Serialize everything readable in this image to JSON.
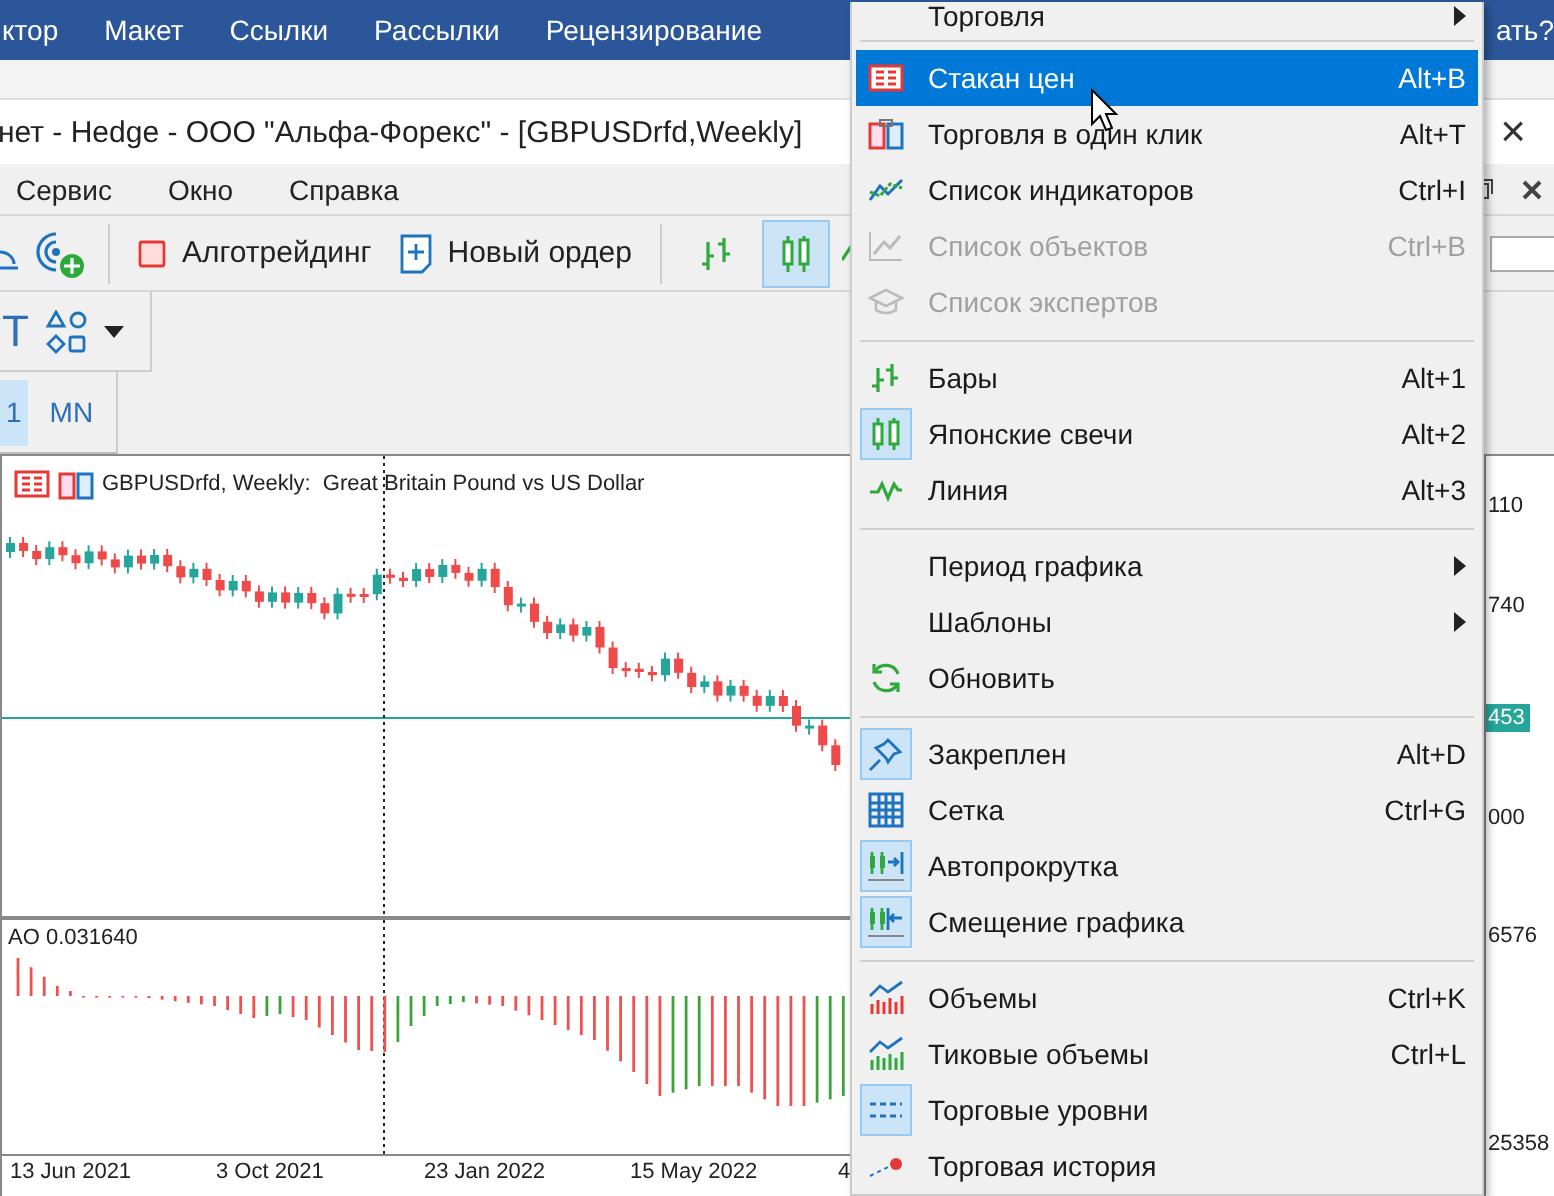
{
  "ribbon": {
    "tabs": [
      "ктор",
      "Макет",
      "Ссылки",
      "Рассылки",
      "Рецензирование"
    ],
    "help_tail": "ать?"
  },
  "window": {
    "title": "нет - Hedge - ООО \"Альфа-Форекс\" - [GBPUSDrfd,Weekly]",
    "close": "×"
  },
  "menubar": [
    "Сервис",
    "Окно",
    "Справка"
  ],
  "toolbar": {
    "buttons": [
      "Алготрейдинг",
      "Новый ордер"
    ],
    "candles_selected": true
  },
  "drawing_toolbar": {
    "text_tool": "T"
  },
  "timeframes": [
    {
      "label": "1",
      "selected": true
    },
    {
      "label": "MN",
      "selected": false
    }
  ],
  "chart": {
    "legend": "GBPUSDrfd, Weekly:  Great Britain Pound vs US Dollar",
    "indicator": "AO 0.031640",
    "dates": [
      "13 Jun 2021",
      "3 Oct 2021",
      "23 Jan 2022",
      "15 May 2022",
      "4"
    ],
    "prices": [
      {
        "text": "110",
        "current": false
      },
      {
        "text": "740",
        "current": false
      },
      {
        "text": "453",
        "current": true
      },
      {
        "text": "000",
        "current": false
      },
      {
        "text": "6576",
        "current": false
      },
      {
        "text": "25358",
        "current": false
      }
    ]
  },
  "context_menu": [
    {
      "kind": "item",
      "label": "Торговля",
      "submenu": true,
      "selected": false,
      "disabled": false,
      "checked": false
    },
    {
      "kind": "separator"
    },
    {
      "kind": "item",
      "label": "Стакан цен",
      "shortcut": "Alt+B",
      "submenu": false,
      "selected": true,
      "disabled": false,
      "checked": false
    },
    {
      "kind": "item",
      "label": "Торговля в один клик",
      "shortcut": "Alt+T",
      "submenu": false,
      "selected": false,
      "disabled": false,
      "checked": false
    },
    {
      "kind": "item",
      "label": "Список индикаторов",
      "shortcut": "Ctrl+I",
      "submenu": false,
      "selected": false,
      "disabled": false,
      "checked": false
    },
    {
      "kind": "item",
      "label": "Список объектов",
      "shortcut": "Ctrl+B",
      "submenu": false,
      "selected": false,
      "disabled": true,
      "checked": false
    },
    {
      "kind": "item",
      "label": "Список экспертов",
      "submenu": false,
      "selected": false,
      "disabled": true,
      "checked": false
    },
    {
      "kind": "separator"
    },
    {
      "kind": "item",
      "label": "Бары",
      "shortcut": "Alt+1",
      "submenu": false,
      "selected": false,
      "disabled": false,
      "checked": false
    },
    {
      "kind": "item",
      "label": "Японские свечи",
      "shortcut": "Alt+2",
      "submenu": false,
      "selected": false,
      "disabled": false,
      "checked": true
    },
    {
      "kind": "item",
      "label": "Линия",
      "shortcut": "Alt+3",
      "submenu": false,
      "selected": false,
      "disabled": false,
      "checked": false
    },
    {
      "kind": "separator"
    },
    {
      "kind": "item",
      "label": "Период графика",
      "submenu": true,
      "selected": false,
      "disabled": false,
      "checked": false
    },
    {
      "kind": "item",
      "label": "Шаблоны",
      "submenu": true,
      "selected": false,
      "disabled": false,
      "checked": false
    },
    {
      "kind": "item",
      "label": "Обновить",
      "submenu": false,
      "selected": false,
      "disabled": false,
      "checked": false
    },
    {
      "kind": "separator"
    },
    {
      "kind": "item",
      "label": "Закреплен",
      "shortcut": "Alt+D",
      "submenu": false,
      "selected": false,
      "disabled": false,
      "checked": true
    },
    {
      "kind": "item",
      "label": "Сетка",
      "shortcut": "Ctrl+G",
      "submenu": false,
      "selected": false,
      "disabled": false,
      "checked": false
    },
    {
      "kind": "item",
      "label": "Автопрокрутка",
      "submenu": false,
      "selected": false,
      "disabled": false,
      "checked": true
    },
    {
      "kind": "item",
      "label": "Смещение графика",
      "submenu": false,
      "selected": false,
      "disabled": false,
      "checked": true
    },
    {
      "kind": "separator"
    },
    {
      "kind": "item",
      "label": "Объемы",
      "shortcut": "Ctrl+K",
      "submenu": false,
      "selected": false,
      "disabled": false,
      "checked": false
    },
    {
      "kind": "item",
      "label": "Тиковые объемы",
      "shortcut": "Ctrl+L",
      "submenu": false,
      "selected": false,
      "disabled": false,
      "checked": false
    },
    {
      "kind": "item",
      "label": "Торговые уровни",
      "submenu": false,
      "selected": false,
      "disabled": false,
      "checked": true
    },
    {
      "kind": "item",
      "label": "Торговая история",
      "submenu": false,
      "selected": false,
      "disabled": false,
      "checked": false
    }
  ]
}
